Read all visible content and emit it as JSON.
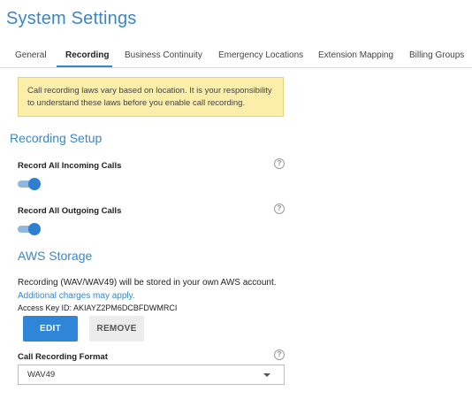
{
  "page": {
    "title": "System Settings"
  },
  "tabs": [
    {
      "label": "General"
    },
    {
      "label": "Recording",
      "active": true
    },
    {
      "label": "Business Continuity"
    },
    {
      "label": "Emergency Locations"
    },
    {
      "label": "Extension Mapping"
    },
    {
      "label": "Billing Groups"
    }
  ],
  "warning": {
    "text": "Call recording laws vary based on location. It is your responsibility to understand these laws before you enable call recording."
  },
  "recording_setup": {
    "heading": "Recording Setup",
    "incoming": {
      "label": "Record All Incoming Calls",
      "enabled": true
    },
    "outgoing": {
      "label": "Record All Outgoing Calls",
      "enabled": true
    }
  },
  "aws": {
    "heading": "AWS Storage",
    "description": "Recording (WAV/WAV49) will be stored in your own AWS account.",
    "link": "Additional charges may apply.",
    "access_key": "Access Key ID: AKIAYZ2PM6DCBFDWMRCI",
    "edit_label": "EDIT",
    "remove_label": "REMOVE"
  },
  "format": {
    "label": "Call Recording Format",
    "value": "WAV49"
  },
  "icons": {
    "help": "question-circle-icon",
    "dropdown": "chevron-down-icon"
  },
  "colors": {
    "accent": "#3a86c8",
    "primary_button": "#2f86d8",
    "warning_bg": "#fbeea8"
  }
}
